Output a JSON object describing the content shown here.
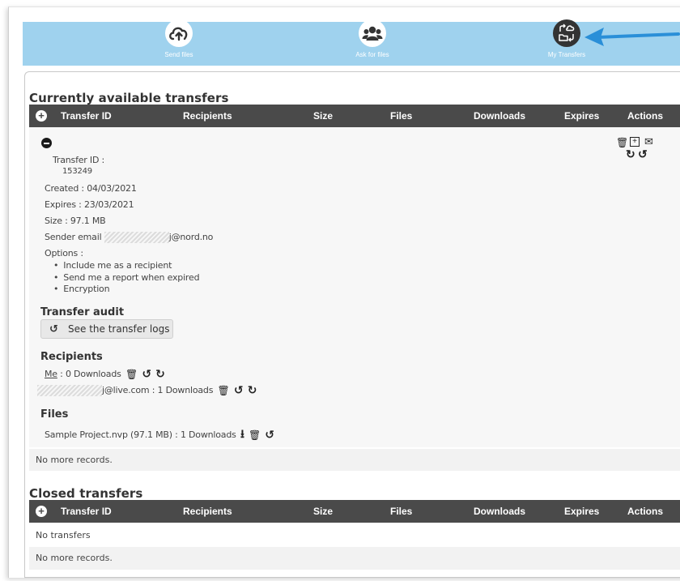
{
  "nav": {
    "send_files": "Send files",
    "ask_for_files": "Ask for files",
    "my_transfers": "My Transfers"
  },
  "colors": {
    "nav_bg": "#9fd2ee",
    "table_header_bg": "#4a4a4a",
    "arrow": "#2a8fd8",
    "nav_icon_bg": "#ffffff",
    "nav_icon_active_bg": "#333333"
  },
  "table_columns": [
    "Transfer ID",
    "Recipients",
    "Size",
    "Files",
    "Downloads",
    "Expires",
    "Actions"
  ],
  "available": {
    "title": "Currently available transfers",
    "transfer": {
      "transfer_id_label": "Transfer ID :",
      "transfer_id": "153249",
      "created": "Created : 04/03/2021",
      "expires": "Expires : 23/03/2021",
      "size": "Size : 97.1 MB",
      "sender_label": "Sender email",
      "sender_suffix": "j@nord.no",
      "options_label": "Options :",
      "options": [
        "Include me as a recipient",
        "Send me a report when expired",
        "Encryption"
      ],
      "audit_title": "Transfer audit",
      "audit_button": "See the transfer logs",
      "recipients_title": "Recipients",
      "recipients": [
        {
          "prefix": "Me",
          "text": " : 0 Downloads"
        },
        {
          "prefix": "",
          "text": "j@live.com : 1 Downloads"
        }
      ],
      "files_title": "Files",
      "files": [
        {
          "text": "Sample Project.nvp (97.1 MB) : 1 Downloads"
        }
      ]
    },
    "no_more": "No more records."
  },
  "closed": {
    "title": "Closed transfers",
    "no_transfers": "No transfers",
    "no_more": "No more records."
  },
  "icons": {
    "expand": "plus-circle-icon",
    "collapse": "minus-circle-icon",
    "delete": "trash-icon",
    "extend": "calendar-plus-icon",
    "email": "envelope-icon",
    "resend": "redo-icon",
    "logs": "history-icon",
    "download": "download-icon"
  }
}
